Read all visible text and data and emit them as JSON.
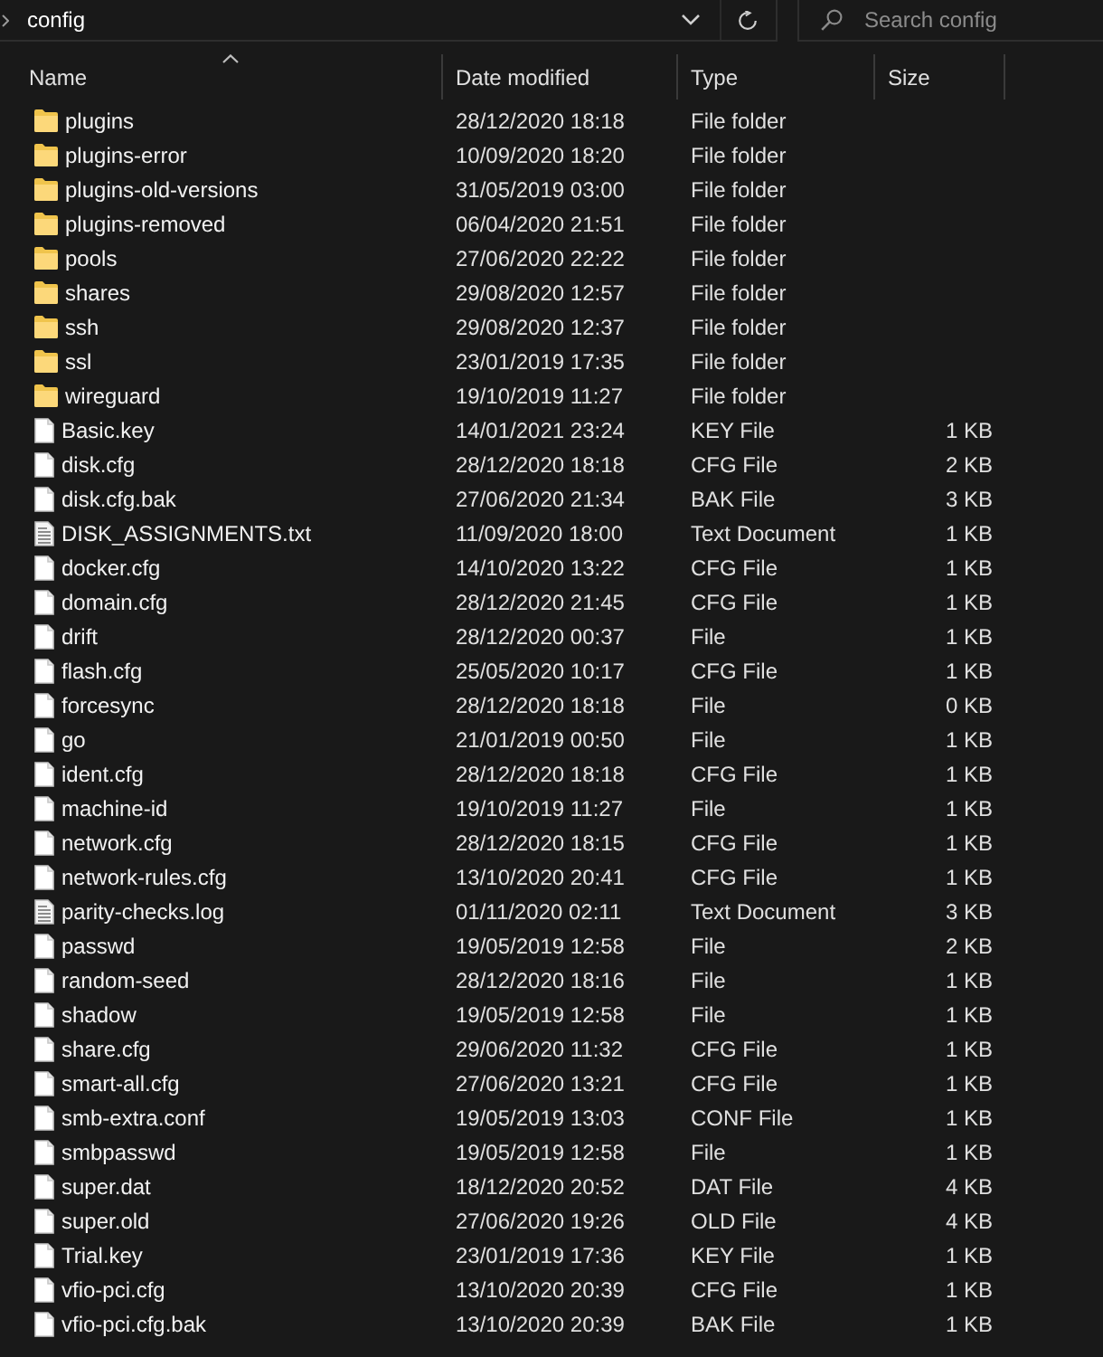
{
  "address_bar": {
    "path": [
      "config"
    ]
  },
  "search": {
    "placeholder": "Search config"
  },
  "columns": [
    {
      "label": "Name",
      "sorted": true
    },
    {
      "label": "Date modified",
      "sorted": false
    },
    {
      "label": "Type",
      "sorted": false
    },
    {
      "label": "Size",
      "sorted": false
    }
  ],
  "rows": [
    {
      "kind": "folder",
      "name": "plugins",
      "date": "28/12/2020 18:18",
      "type": "File folder"
    },
    {
      "kind": "folder",
      "name": "plugins-error",
      "date": "10/09/2020 18:20",
      "type": "File folder"
    },
    {
      "kind": "folder",
      "name": "plugins-old-versions",
      "date": "31/05/2019 03:00",
      "type": "File folder"
    },
    {
      "kind": "folder",
      "name": "plugins-removed",
      "date": "06/04/2020 21:51",
      "type": "File folder"
    },
    {
      "kind": "folder",
      "name": "pools",
      "date": "27/06/2020 22:22",
      "type": "File folder"
    },
    {
      "kind": "folder",
      "name": "shares",
      "date": "29/08/2020 12:57",
      "type": "File folder"
    },
    {
      "kind": "folder",
      "name": "ssh",
      "date": "29/08/2020 12:37",
      "type": "File folder"
    },
    {
      "kind": "folder",
      "name": "ssl",
      "date": "23/01/2019 17:35",
      "type": "File folder"
    },
    {
      "kind": "folder",
      "name": "wireguard",
      "date": "19/10/2019 11:27",
      "type": "File folder"
    },
    {
      "kind": "file",
      "name": "Basic.key",
      "date": "14/01/2021 23:24",
      "type": "KEY File",
      "size": "1 KB"
    },
    {
      "kind": "file",
      "name": "disk.cfg",
      "date": "28/12/2020 18:18",
      "type": "CFG File",
      "size": "2 KB"
    },
    {
      "kind": "file",
      "name": "disk.cfg.bak",
      "date": "27/06/2020 21:34",
      "type": "BAK File",
      "size": "3 KB"
    },
    {
      "kind": "text",
      "name": "DISK_ASSIGNMENTS.txt",
      "date": "11/09/2020 18:00",
      "type": "Text Document",
      "size": "1 KB"
    },
    {
      "kind": "file",
      "name": "docker.cfg",
      "date": "14/10/2020 13:22",
      "type": "CFG File",
      "size": "1 KB"
    },
    {
      "kind": "file",
      "name": "domain.cfg",
      "date": "28/12/2020 21:45",
      "type": "CFG File",
      "size": "1 KB"
    },
    {
      "kind": "file",
      "name": "drift",
      "date": "28/12/2020 00:37",
      "type": "File",
      "size": "1 KB"
    },
    {
      "kind": "file",
      "name": "flash.cfg",
      "date": "25/05/2020 10:17",
      "type": "CFG File",
      "size": "1 KB"
    },
    {
      "kind": "file",
      "name": "forcesync",
      "date": "28/12/2020 18:18",
      "type": "File",
      "size": "0 KB"
    },
    {
      "kind": "file",
      "name": "go",
      "date": "21/01/2019 00:50",
      "type": "File",
      "size": "1 KB"
    },
    {
      "kind": "file",
      "name": "ident.cfg",
      "date": "28/12/2020 18:18",
      "type": "CFG File",
      "size": "1 KB"
    },
    {
      "kind": "file",
      "name": "machine-id",
      "date": "19/10/2019 11:27",
      "type": "File",
      "size": "1 KB"
    },
    {
      "kind": "file",
      "name": "network.cfg",
      "date": "28/12/2020 18:15",
      "type": "CFG File",
      "size": "1 KB"
    },
    {
      "kind": "file",
      "name": "network-rules.cfg",
      "date": "13/10/2020 20:41",
      "type": "CFG File",
      "size": "1 KB"
    },
    {
      "kind": "text",
      "name": "parity-checks.log",
      "date": "01/11/2020 02:11",
      "type": "Text Document",
      "size": "3 KB"
    },
    {
      "kind": "file",
      "name": "passwd",
      "date": "19/05/2019 12:58",
      "type": "File",
      "size": "2 KB"
    },
    {
      "kind": "file",
      "name": "random-seed",
      "date": "28/12/2020 18:16",
      "type": "File",
      "size": "1 KB"
    },
    {
      "kind": "file",
      "name": "shadow",
      "date": "19/05/2019 12:58",
      "type": "File",
      "size": "1 KB"
    },
    {
      "kind": "file",
      "name": "share.cfg",
      "date": "29/06/2020 11:32",
      "type": "CFG File",
      "size": "1 KB"
    },
    {
      "kind": "file",
      "name": "smart-all.cfg",
      "date": "27/06/2020 13:21",
      "type": "CFG File",
      "size": "1 KB"
    },
    {
      "kind": "file",
      "name": "smb-extra.conf",
      "date": "19/05/2019 13:03",
      "type": "CONF File",
      "size": "1 KB"
    },
    {
      "kind": "file",
      "name": "smbpasswd",
      "date": "19/05/2019 12:58",
      "type": "File",
      "size": "1 KB"
    },
    {
      "kind": "file",
      "name": "super.dat",
      "date": "18/12/2020 20:52",
      "type": "DAT File",
      "size": "4 KB"
    },
    {
      "kind": "file",
      "name": "super.old",
      "date": "27/06/2020 19:26",
      "type": "OLD File",
      "size": "4 KB"
    },
    {
      "kind": "file",
      "name": "Trial.key",
      "date": "23/01/2019 17:36",
      "type": "KEY File",
      "size": "1 KB"
    },
    {
      "kind": "file",
      "name": "vfio-pci.cfg",
      "date": "13/10/2020 20:39",
      "type": "CFG File",
      "size": "1 KB"
    },
    {
      "kind": "file",
      "name": "vfio-pci.cfg.bak",
      "date": "13/10/2020 20:39",
      "type": "BAK File",
      "size": "1 KB"
    }
  ]
}
